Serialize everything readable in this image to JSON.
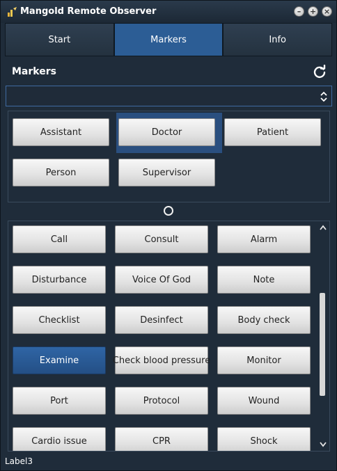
{
  "window": {
    "title": "Mangold Remote Observer",
    "controls": {
      "minimize": "–",
      "maximize": "+",
      "close": "×"
    }
  },
  "tabs": [
    {
      "label": "Start",
      "active": false
    },
    {
      "label": "Markers",
      "active": true
    },
    {
      "label": "Info",
      "active": false
    }
  ],
  "markers": {
    "title": "Markers",
    "dropdown_value": "",
    "top_buttons": [
      "Assistant",
      "Doctor",
      "Patient",
      "Person",
      "Supervisor"
    ],
    "top_selected": "Doctor",
    "bottom_buttons": [
      "Call",
      "Consult",
      "Alarm",
      "Disturbance",
      "Voice Of God",
      "Note",
      "Checklist",
      "Desinfect",
      "Body check",
      "Examine",
      "Check blood pressure",
      "Monitor",
      "Port",
      "Protocol",
      "Wound",
      "Cardio issue",
      "CPR",
      "Shock"
    ],
    "bottom_active": "Examine"
  },
  "status": {
    "label": "Label3"
  },
  "colors": {
    "accent": "#2c5d95",
    "background": "#1f2c3a"
  },
  "icons": {
    "refresh": "refresh-icon",
    "dropdown": "chevron-updown-icon",
    "app": "app-icon"
  }
}
